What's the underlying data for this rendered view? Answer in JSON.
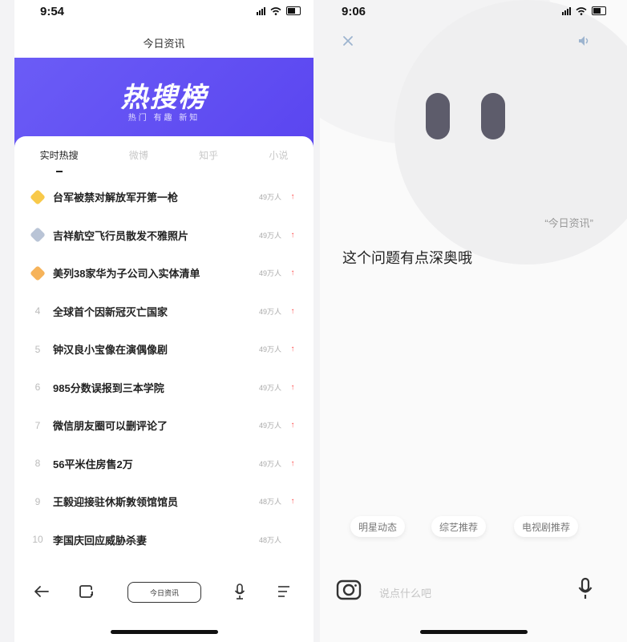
{
  "left": {
    "status_time": "9:54",
    "page_title": "今日资讯",
    "banner_title": "热搜榜",
    "banner_subtitle": "热门 有趣 新知",
    "tabs": [
      {
        "label": "实时热搜"
      },
      {
        "label": "微博"
      },
      {
        "label": "知乎"
      },
      {
        "label": "小说"
      }
    ],
    "items": [
      {
        "rank": "1",
        "title": "台军被禁对解放军开第一枪",
        "count": "49万人",
        "medal_color": "#f8c94a",
        "trend": "up"
      },
      {
        "rank": "2",
        "title": "吉祥航空飞行员散发不雅照片",
        "count": "49万人",
        "medal_color": "#b9c4d6",
        "trend": "up"
      },
      {
        "rank": "3",
        "title": "美列38家华为子公司入实体清单",
        "count": "49万人",
        "medal_color": "#f6b35a",
        "trend": "up"
      },
      {
        "rank": "4",
        "title": "全球首个因新冠灭亡国家",
        "count": "49万人",
        "trend": "up"
      },
      {
        "rank": "5",
        "title": "钟汉良小宝像在演偶像剧",
        "count": "49万人",
        "trend": "up"
      },
      {
        "rank": "6",
        "title": "985分数误报到三本学院",
        "count": "49万人",
        "trend": "up"
      },
      {
        "rank": "7",
        "title": "微信朋友圈可以删评论了",
        "count": "49万人",
        "trend": "up"
      },
      {
        "rank": "8",
        "title": "56平米住房售2万",
        "count": "49万人",
        "trend": "up"
      },
      {
        "rank": "9",
        "title": "王毅迎接驻休斯敦领馆馆员",
        "count": "48万人",
        "trend": "up"
      },
      {
        "rank": "10",
        "title": "李国庆回应威胁杀妻",
        "count": "48万人",
        "trend": ""
      }
    ],
    "bottom_pill": "今日资讯"
  },
  "right": {
    "status_time": "9:06",
    "quote": "“今日资讯”",
    "answer": "这个问题有点深奥哦",
    "suggestions": [
      "明星动态",
      "综艺推荐",
      "电视剧推荐"
    ],
    "input_placeholder": "说点什么吧"
  },
  "colors": {
    "banner": "#5a45f0",
    "trend_up": "#ff4d4d"
  },
  "icons": {
    "back": "arrow-left-icon",
    "tabs": "tabs-icon",
    "mic": "microphone-icon",
    "menu": "menu-icon",
    "close": "close-icon",
    "speaker": "speaker-icon",
    "camera": "camera-icon"
  }
}
